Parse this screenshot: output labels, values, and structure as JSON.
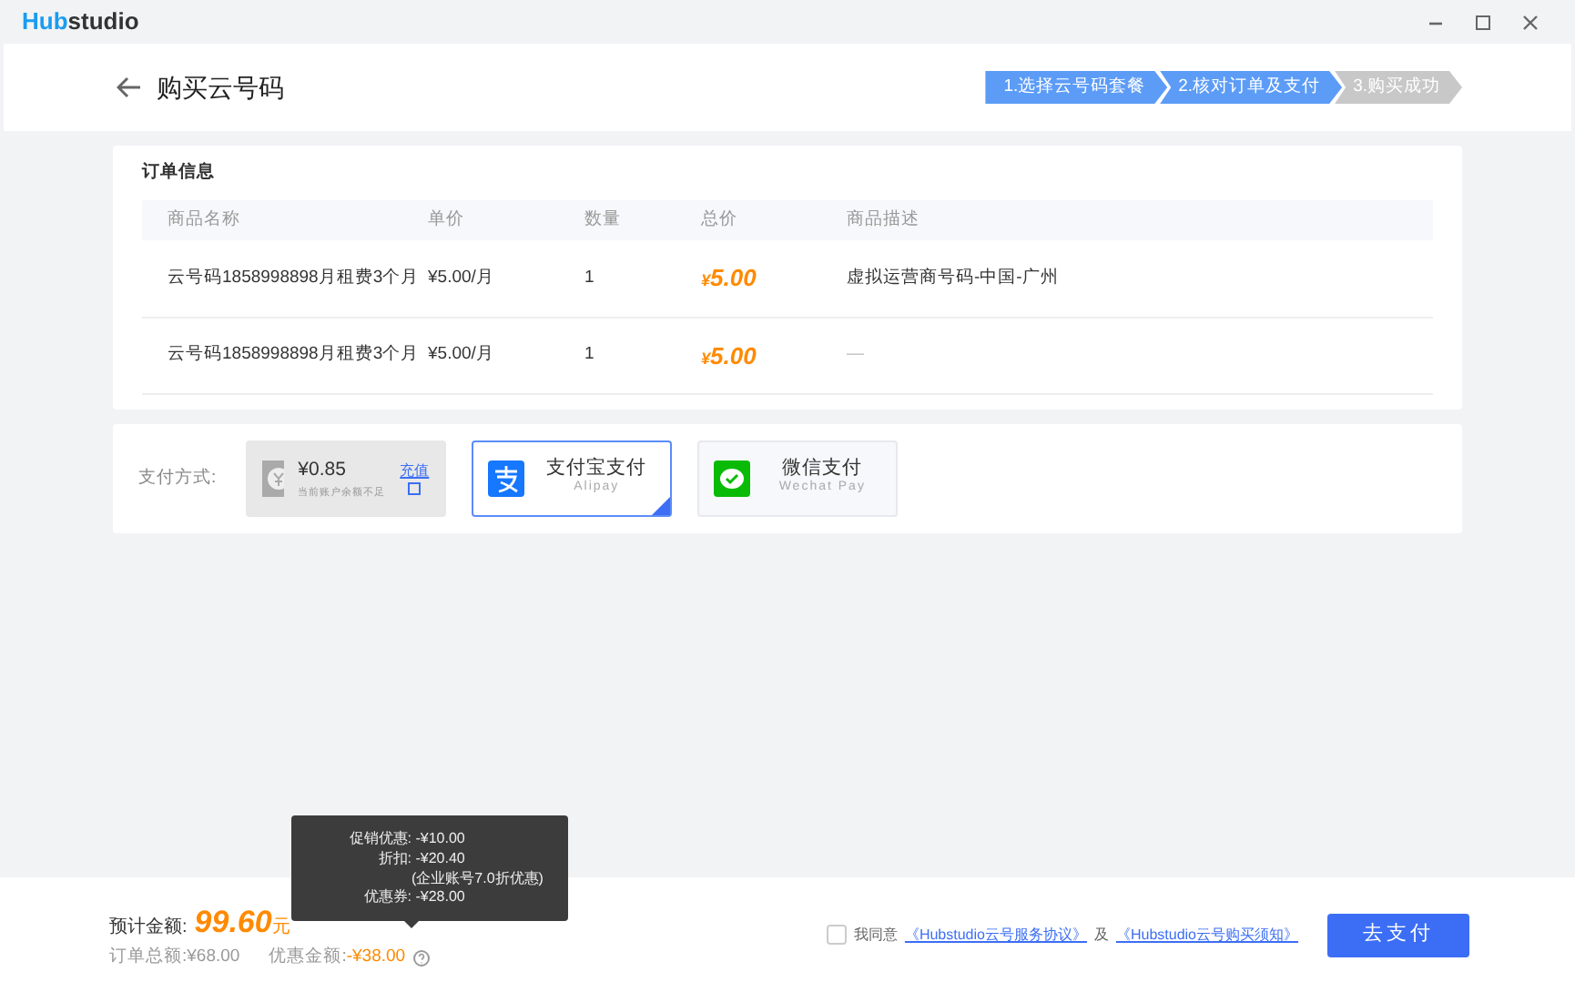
{
  "window": {
    "logo_accent": "Hub",
    "logo_rest": "studio"
  },
  "header": {
    "title": "购买云号码",
    "steps": [
      {
        "label": "1.选择云号码套餐",
        "done": true
      },
      {
        "label": "2.核对订单及支付",
        "done": true
      },
      {
        "label": "3.购买成功",
        "done": false
      }
    ]
  },
  "order": {
    "title": "订单信息",
    "columns": [
      "商品名称",
      "单价",
      "数量",
      "总价",
      "商品描述"
    ],
    "rows": [
      {
        "name": "云号码1858998898月租费3个月",
        "unit_price": "¥5.00/月",
        "quantity": "1",
        "currency": "¥",
        "total": "5.00",
        "description": "虚拟运营商号码-中国-广州"
      },
      {
        "name": "云号码1858998898月租费3个月",
        "unit_price": "¥5.00/月",
        "quantity": "1",
        "currency": "¥",
        "total": "5.00",
        "description": "—"
      }
    ]
  },
  "payment": {
    "label": "支付方式:",
    "methods": [
      {
        "kind": "balance",
        "amount": "¥0.85",
        "note": "当前账户余额不足",
        "action": "充值",
        "selected": false,
        "disabled": true
      },
      {
        "kind": "alipay",
        "name": "支付宝支付",
        "sub": "Alipay",
        "selected": true,
        "disabled": false
      },
      {
        "kind": "wechat",
        "name": "微信支付",
        "sub": "Wechat Pay",
        "selected": false,
        "disabled": false
      }
    ]
  },
  "footer": {
    "estimate_label": "预计金额:",
    "estimate_value": "99.60",
    "estimate_unit": "元",
    "total_label": "订单总额:",
    "total_value": "¥68.00",
    "discount_label": "优惠金额:",
    "discount_value": "-¥38.00",
    "tooltip": [
      {
        "label": "促销优惠:",
        "value": "-¥10.00"
      },
      {
        "label": "折扣:",
        "value": "-¥20.40",
        "note": "(企业账号7.0折优惠)"
      },
      {
        "label": "优惠券:",
        "value": "-¥28.00"
      }
    ],
    "agree_checked": false,
    "agree_text": "我同意",
    "link_1": "《Hubstudio云号服务协议》",
    "and_text": "及",
    "link_2": "《Hubstudio云号购买须知》",
    "pay_button": "去支付"
  }
}
